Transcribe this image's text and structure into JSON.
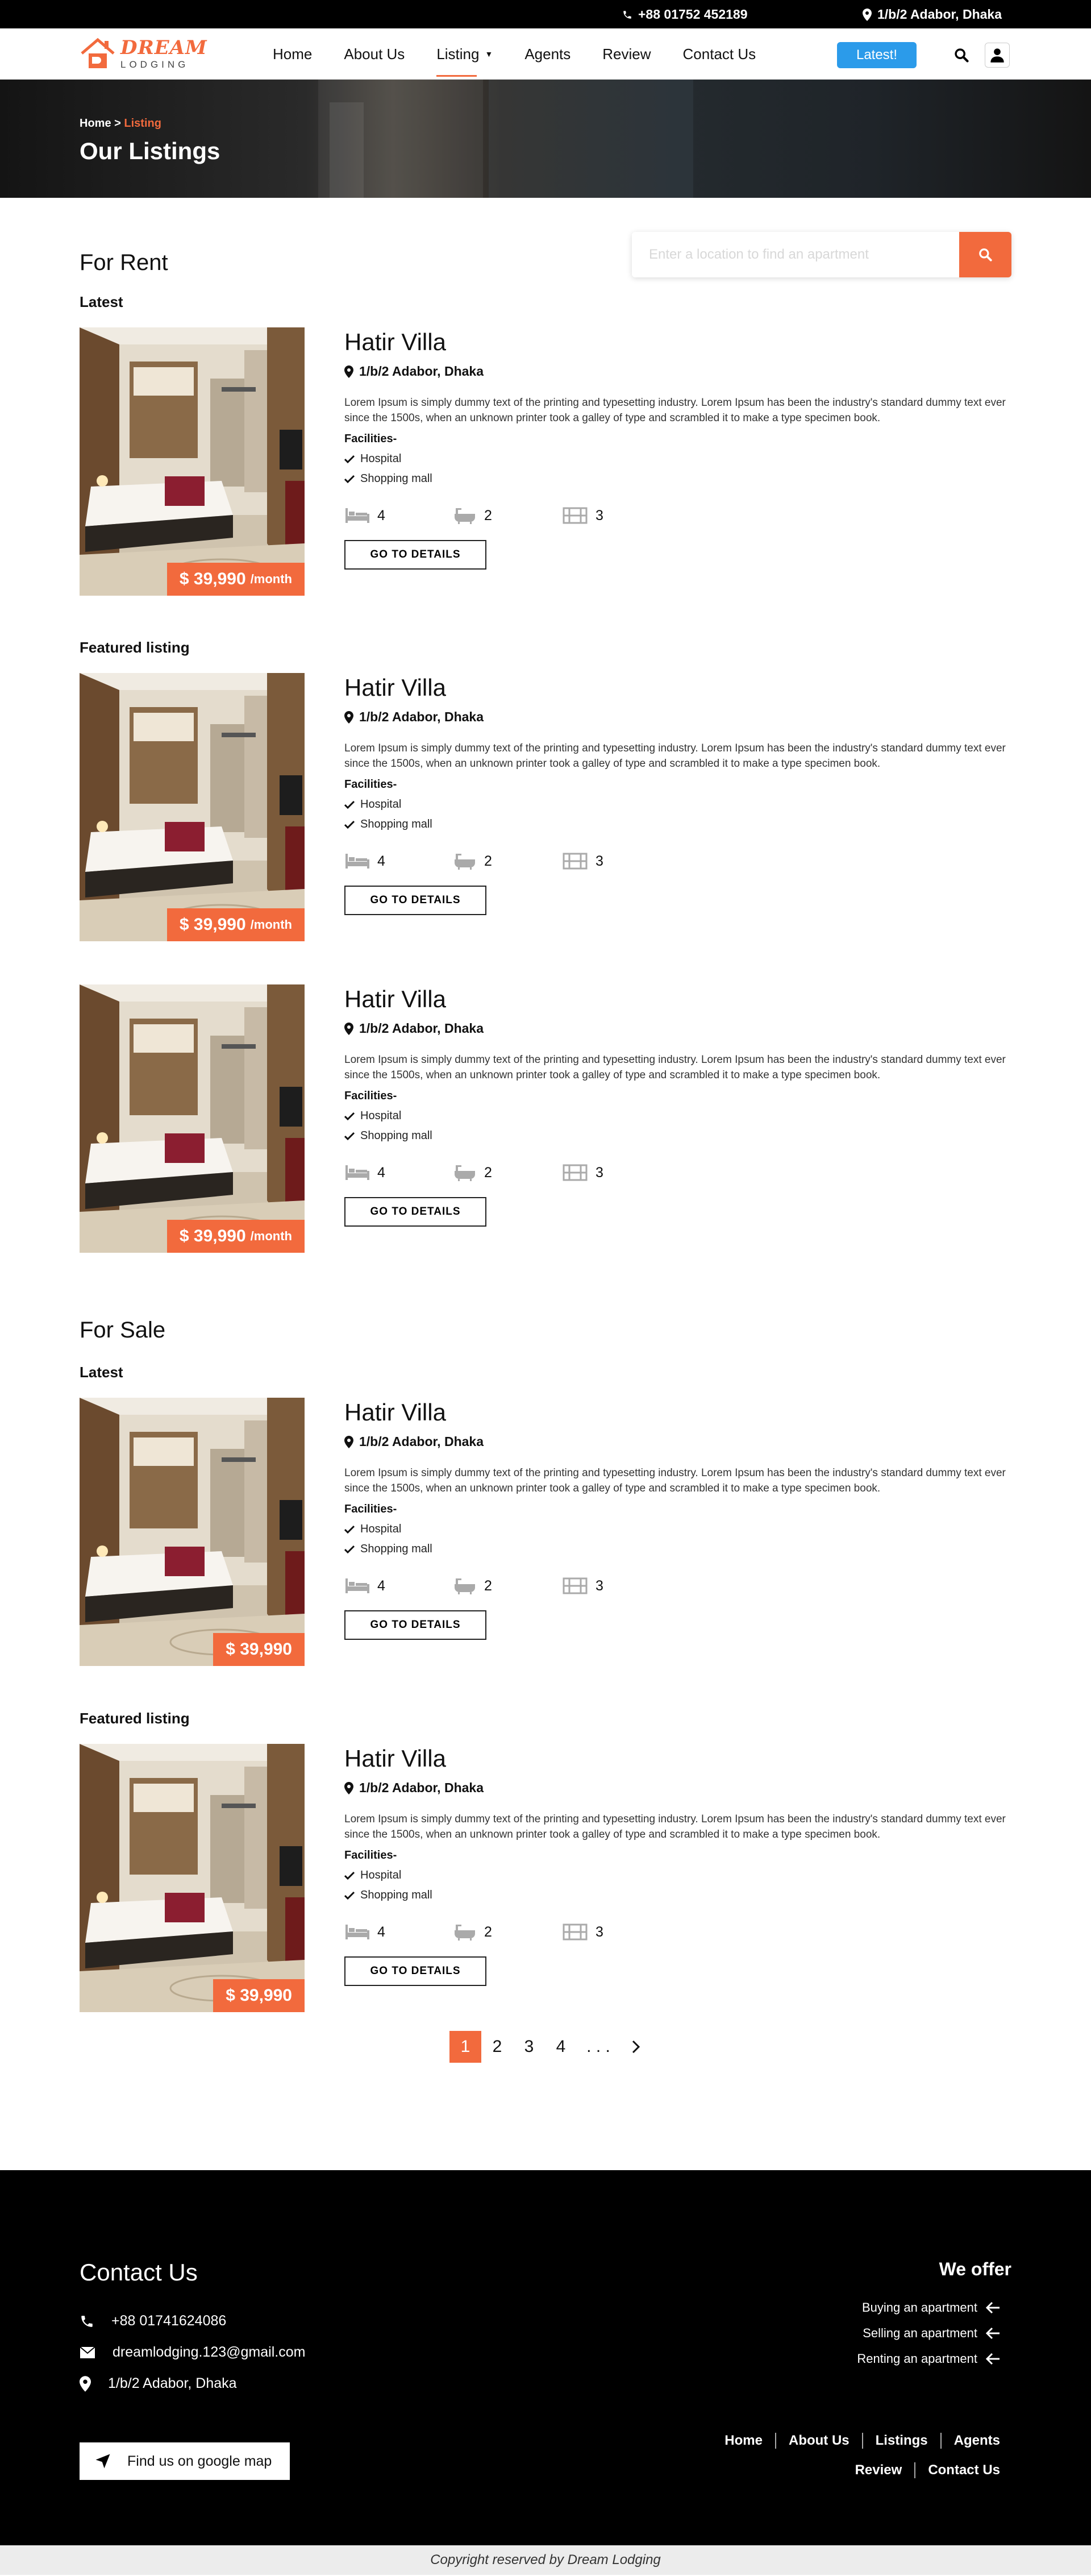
{
  "topbar": {
    "phone": "+88 01752 452189",
    "address": "1/b/2 Adabor, Dhaka"
  },
  "brand": {
    "name_top": "DREAM",
    "name_bottom": "LODGING"
  },
  "nav": {
    "items": [
      {
        "label": "Home"
      },
      {
        "label": "About Us"
      },
      {
        "label": "Listing"
      },
      {
        "label": "Agents"
      },
      {
        "label": "Review"
      },
      {
        "label": "Contact Us"
      }
    ],
    "active_index": 2,
    "latest_label": "Latest!"
  },
  "hero": {
    "breadcrumb_home": "Home",
    "breadcrumb_sep": ">",
    "breadcrumb_current": "Listing",
    "title": "Our Listings"
  },
  "search": {
    "placeholder": "Enter a location to find an apartment"
  },
  "sections": {
    "rent_title": "For Rent",
    "sale_title": "For Sale",
    "latest": "Latest",
    "featured": "Featured listing"
  },
  "listing": {
    "name": "Hatir Villa",
    "location": "1/b/2 Adabor, Dhaka",
    "description": "Lorem Ipsum is simply dummy text of the printing and typesetting industry. Lorem Ipsum has been the industry's standard dummy text ever since the 1500s, when an unknown printer took a galley of type and scrambled it to make a type specimen book.",
    "facilities_label": "Facilities-",
    "facilities": [
      "Hospital",
      "Shopping mall"
    ],
    "beds": "4",
    "baths": "2",
    "floors": "3",
    "details_label": "GO TO DETAILS",
    "rent_price": "$ 39,990",
    "rent_period": "/month",
    "sale_price": "$ 39,990"
  },
  "pagination": {
    "pages": [
      "1",
      "2",
      "3",
      "4",
      ". . ."
    ],
    "active": "1",
    "next": "›"
  },
  "footer": {
    "contact_title": "Contact Us",
    "phone": "+88 01741624086",
    "email": "dreamlodging.123@gmail.com",
    "address": "1/b/2 Adabor, Dhaka",
    "maps_label": "Find us on google map",
    "offer_title": "We offer",
    "offers": [
      "Buying an apartment",
      "Selling an apartment",
      "Renting an apartment"
    ],
    "links_row1": [
      "Home",
      "About Us",
      "Listings",
      "Agents"
    ],
    "links_row2": [
      "Review",
      "Contact Us"
    ],
    "copyright": "Copyright reserved by Dream Lodging"
  },
  "colors": {
    "accent": "#f26a3d",
    "latest_button": "#2b9bea",
    "footer_bg": "#000000"
  }
}
